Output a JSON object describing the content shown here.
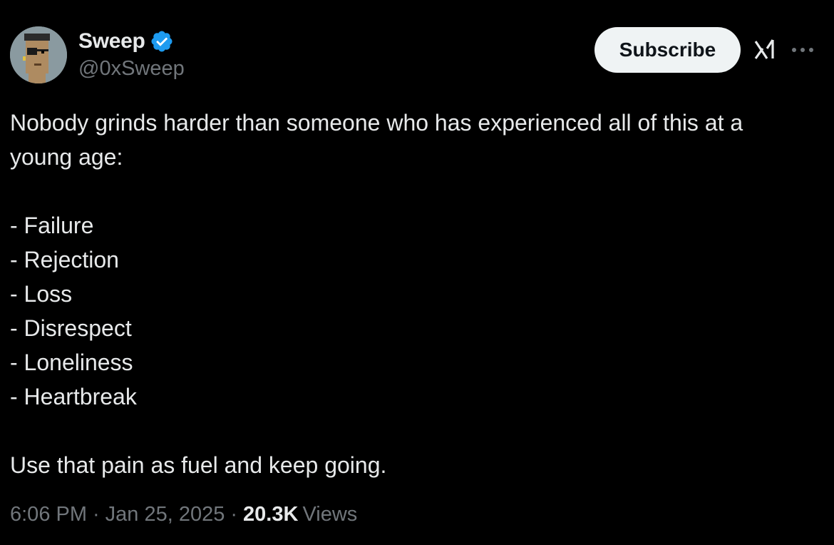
{
  "author": {
    "display_name": "Sweep",
    "handle": "@0xSweep",
    "verified": true,
    "verified_color": "#1d9bf0",
    "avatar_icon": "pixel-punk-avatar"
  },
  "actions": {
    "subscribe_label": "Subscribe",
    "grok_icon": "grok-icon",
    "more_icon": "more-icon"
  },
  "post": {
    "intro_line1": "Nobody grinds harder than someone who has experienced all of this at a",
    "intro_line2": "young age:",
    "items": [
      "- Failure",
      "- Rejection",
      "- Loss",
      "- Disrespect",
      "- Loneliness",
      "- Heartbreak"
    ],
    "closing": "Use that pain as fuel and keep going."
  },
  "meta": {
    "time": "6:06 PM",
    "date": "Jan 25, 2025",
    "separator": "·",
    "views_count": "20.3K",
    "views_label": "Views"
  }
}
